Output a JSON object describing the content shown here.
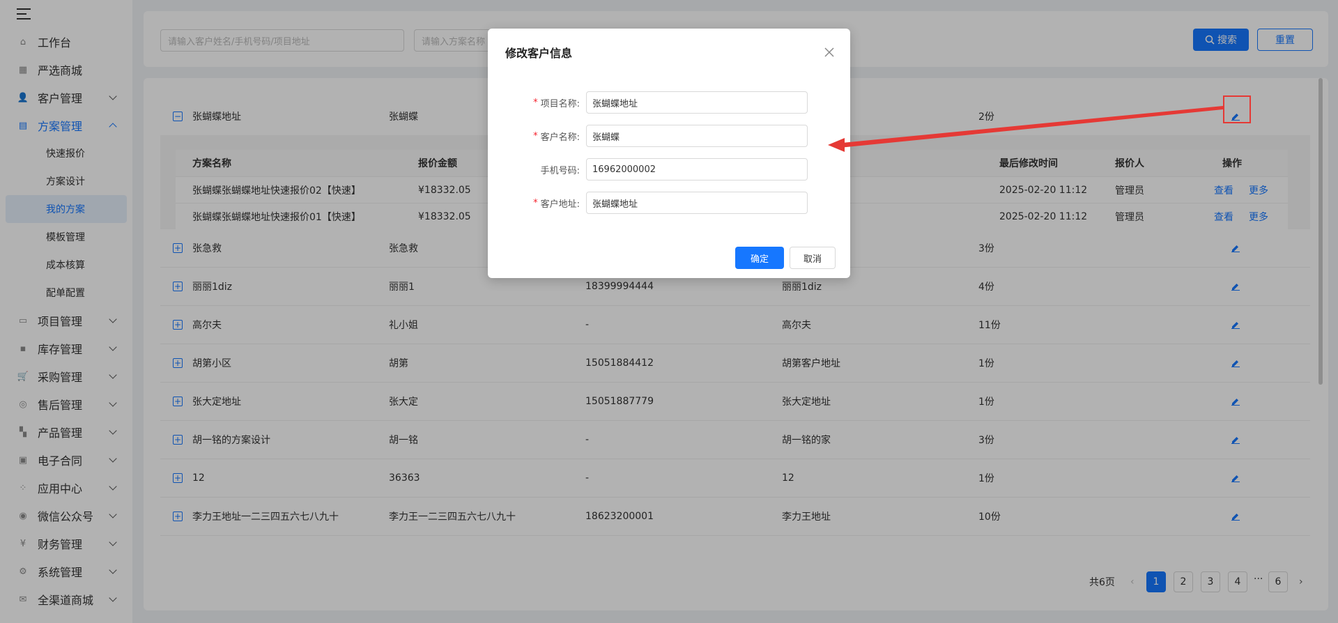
{
  "sidebar": {
    "menu": [
      {
        "label": "工作台",
        "icon": "home-icon",
        "expandable": false
      },
      {
        "label": "严选商城",
        "icon": "chart-icon",
        "expandable": false
      },
      {
        "label": "客户管理",
        "icon": "users-icon",
        "expandable": true
      },
      {
        "label": "方案管理",
        "icon": "document-icon",
        "expandable": true,
        "open": true
      }
    ],
    "submenu": [
      "快速报价",
      "方案设计",
      "我的方案",
      "模板管理",
      "成本核算",
      "配单配置"
    ],
    "active_submenu": "我的方案",
    "menu_rest": [
      "项目管理",
      "库存管理",
      "采购管理",
      "售后管理",
      "产品管理",
      "电子合同",
      "应用中心",
      "微信公众号",
      "财务管理",
      "系统管理",
      "全渠道商城"
    ]
  },
  "filter": {
    "customer_placeholder": "请输入客户姓名/手机号码/项目地址",
    "plan_placeholder": "请输入方案名称",
    "search_label": "搜索",
    "reset_label": "重置"
  },
  "table": {
    "expanded_row": {
      "project": "张蝴蝶地址",
      "customer": "张蝴蝶",
      "count": "2份"
    },
    "sub_table": {
      "headers": {
        "name": "方案名称",
        "amount": "报价金额",
        "modified": "最后修改时间",
        "quoter": "报价人",
        "ops": "操作"
      },
      "rows": [
        {
          "name": "张蝴蝶张蝴蝶地址快速报价02【快速】",
          "amount": "¥18332.05",
          "modified": "2025-02-20 11:12",
          "quoter": "管理员",
          "view": "查看",
          "more": "更多"
        },
        {
          "name": "张蝴蝶张蝴蝶地址快速报价01【快速】",
          "amount": "¥18332.05",
          "modified": "2025-02-20 11:12",
          "quoter": "管理员",
          "view": "查看",
          "more": "更多"
        }
      ]
    },
    "rows": [
      {
        "project": "张急救",
        "customer": "张急救",
        "phone": "",
        "address": "",
        "count": "3份"
      },
      {
        "project": "丽丽1diz",
        "customer": "丽丽1",
        "phone": "18399994444",
        "address": "丽丽1diz",
        "count": "4份"
      },
      {
        "project": "高尔夫",
        "customer": "礼小姐",
        "phone": "-",
        "address": "高尔夫",
        "count": "11份"
      },
      {
        "project": "胡第小区",
        "customer": "胡第",
        "phone": "15051884412",
        "address": "胡第客户地址",
        "count": "1份"
      },
      {
        "project": "张大定地址",
        "customer": "张大定",
        "phone": "15051887779",
        "address": "张大定地址",
        "count": "1份"
      },
      {
        "project": "胡一铭的方案设计",
        "customer": "胡一铭",
        "phone": "-",
        "address": "胡一铭的家",
        "count": "3份"
      },
      {
        "project": "12",
        "customer": "36363",
        "phone": "-",
        "address": "12",
        "count": "1份"
      },
      {
        "project": "李力王地址一二三四五六七八九十",
        "customer": "李力王一二三四五六七八九十",
        "phone": "18623200001",
        "address": "李力王地址",
        "count": "10份"
      }
    ]
  },
  "pagination": {
    "total_label": "共6页",
    "pages": [
      "1",
      "2",
      "3",
      "4",
      "6"
    ],
    "ellipsis": "···",
    "current": "1"
  },
  "modal": {
    "title": "修改客户信息",
    "fields": [
      {
        "label": "项目名称:",
        "required": true,
        "value": "张蝴蝶地址"
      },
      {
        "label": "客户名称:",
        "required": true,
        "value": "张蝴蝶"
      },
      {
        "label": "手机号码:",
        "required": false,
        "value": "16962000002"
      },
      {
        "label": "客户地址:",
        "required": true,
        "value": "张蝴蝶地址"
      }
    ],
    "confirm_label": "确定",
    "cancel_label": "取消"
  },
  "colors": {
    "primary": "#1677ff",
    "annotation": "#e53935",
    "required": "#f5222d"
  }
}
